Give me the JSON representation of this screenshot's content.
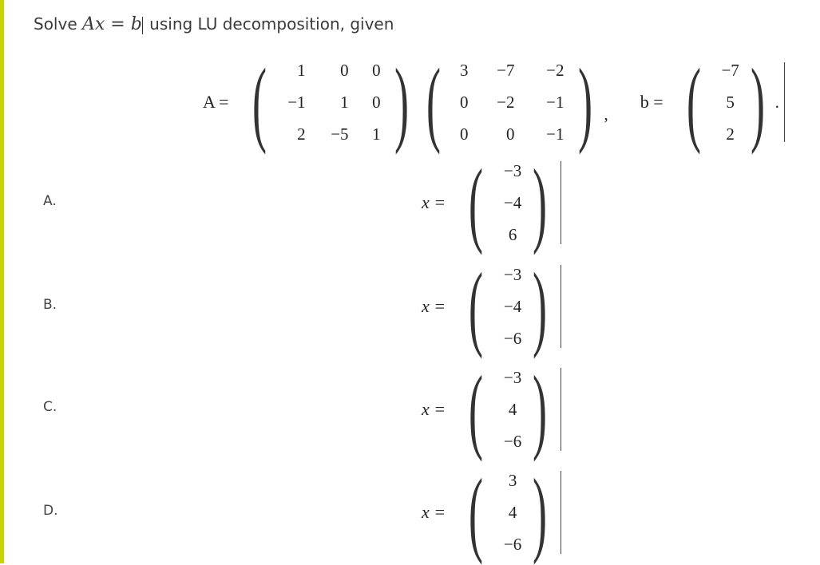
{
  "accent_color": "#c8d400",
  "question": {
    "prefix": "Solve ",
    "equation": "Ax = b",
    "suffix": " using LU decomposition, given"
  },
  "given": {
    "A_label": "A =",
    "L": [
      [
        "1",
        "0",
        "0"
      ],
      [
        "−1",
        "1",
        "0"
      ],
      [
        "2",
        "−5",
        "1"
      ]
    ],
    "U": [
      [
        "3",
        "−7",
        "−2"
      ],
      [
        "0",
        "−2",
        "−1"
      ],
      [
        "0",
        "0",
        "−1"
      ]
    ],
    "separator": ",",
    "b_label": "b =",
    "b": [
      "−7",
      "5",
      "2"
    ],
    "terminator": "."
  },
  "options": [
    {
      "label": "A.",
      "x_label": "x =",
      "x": [
        "−3",
        "−4",
        "6"
      ]
    },
    {
      "label": "B.",
      "x_label": "x =",
      "x": [
        "−3",
        "−4",
        "−6"
      ]
    },
    {
      "label": "C.",
      "x_label": "x =",
      "x": [
        "−3",
        "4",
        "−6"
      ]
    },
    {
      "label": "D.",
      "x_label": "x =",
      "x": [
        "3",
        "4",
        "−6"
      ]
    }
  ]
}
